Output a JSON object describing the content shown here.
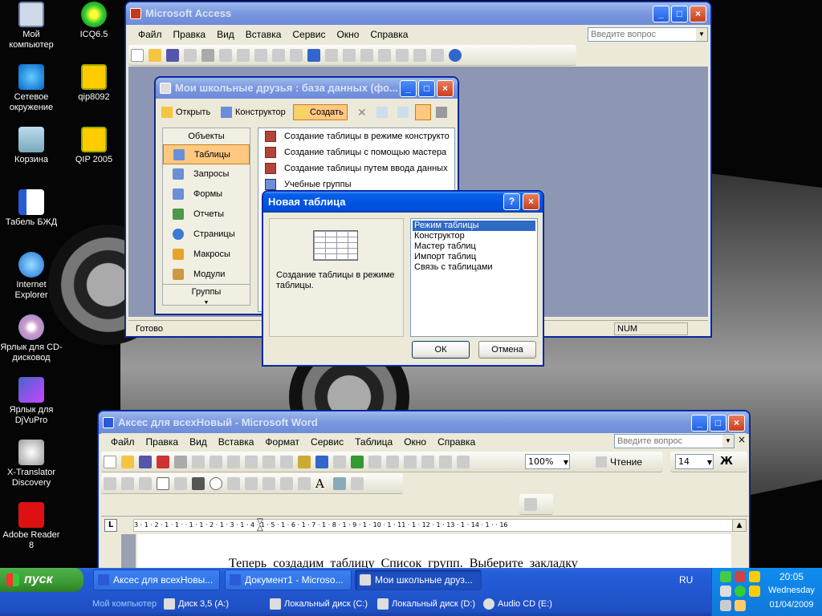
{
  "desktop": {
    "icons": [
      {
        "label": "Мой компьютер",
        "icon": "my-computer-icon"
      },
      {
        "label": "Сетевое окружение",
        "icon": "network-icon"
      },
      {
        "label": "Корзина",
        "icon": "recycle-bin-icon"
      },
      {
        "label": "Табель БЖД",
        "icon": "word-doc-icon"
      },
      {
        "label": "Internet Explorer",
        "icon": "ie-icon"
      },
      {
        "label": "Ярлык для CD-дисковод",
        "icon": "cd-drive-icon"
      },
      {
        "label": "Ярлык для DjVuPro",
        "icon": "djvu-icon"
      },
      {
        "label": "X-Translator Discovery",
        "icon": "translator-icon"
      },
      {
        "label": "Adobe Reader 8",
        "icon": "adobe-reader-icon"
      },
      {
        "label": "ICQ6.5",
        "icon": "icq-icon"
      },
      {
        "label": "qip8092",
        "icon": "qip-icon"
      },
      {
        "label": "QIP 2005",
        "icon": "qip-icon"
      }
    ]
  },
  "access": {
    "title": "Microsoft Access",
    "menu": [
      "Файл",
      "Правка",
      "Вид",
      "Вставка",
      "Сервис",
      "Окно",
      "Справка"
    ],
    "ask_placeholder": "Введите вопрос",
    "status": "Готово",
    "status_num": "NUM"
  },
  "db": {
    "title": "Мои школьные друзья : база данных (фо...",
    "toolbar": {
      "open": "Открыть",
      "design": "Конструктор",
      "create": "Создать"
    },
    "sidebar_header": "Объекты",
    "sidebar_items": [
      "Таблицы",
      "Запросы",
      "Формы",
      "Отчеты",
      "Страницы",
      "Макросы",
      "Модули"
    ],
    "groups_label": "Группы",
    "list_items": [
      "Создание таблицы в режиме конструкто",
      "Создание таблицы с помощью мастера",
      "Создание таблицы путем ввода данных",
      "Учебные группы"
    ]
  },
  "dialog": {
    "title": "Новая таблица",
    "help": "?",
    "description": "Создание таблицы в режиме таблицы.",
    "options": [
      "Режим таблицы",
      "Конструктор",
      "Мастер таблиц",
      "Импорт таблиц",
      "Связь с таблицами"
    ],
    "ok": "ОК",
    "cancel": "Отмена"
  },
  "word": {
    "title": "Аксес для всехНовый - Microsoft Word",
    "menu": [
      "Файл",
      "Правка",
      "Вид",
      "Вставка",
      "Формат",
      "Сервис",
      "Таблица",
      "Окно",
      "Справка"
    ],
    "ask_placeholder": "Введите вопрос",
    "zoom": "100%",
    "reading": "Чтение",
    "font_size": "14",
    "bold": "Ж",
    "ruler_marks": "3 · 1 · 2 · 1 · 1 · · 1 · 1 · 2 · 1 · 3 · 1 · 4 · 1 · 5 · 1 · 6 · 1 · 7 · 1 · 8 · 1 · 9 · 1 · 10 · 1 · 11 · 1 · 12 · 1 · 13 · 1 · 14 · 1 · · 16",
    "doc_text": "Теперь  создадим  таблицу  Список  групп.  Выберите  закладку"
  },
  "taskbar": {
    "start": "пуск",
    "tasks": [
      {
        "label": "Аксес для всехНовы...",
        "active": false
      },
      {
        "label": "Документ1 - Microso...",
        "active": false
      },
      {
        "label": "Мои школьные друз...",
        "active": true
      }
    ],
    "quick_links": [
      "Мой компьютер",
      "Диск 3,5 (A:)",
      "Локальный диск (C:)",
      "Локальный диск (D:)",
      "Audio CD (E:)"
    ],
    "lang": "RU",
    "time": "20:05",
    "day": "Wednesday",
    "date": "01/04/2009"
  }
}
